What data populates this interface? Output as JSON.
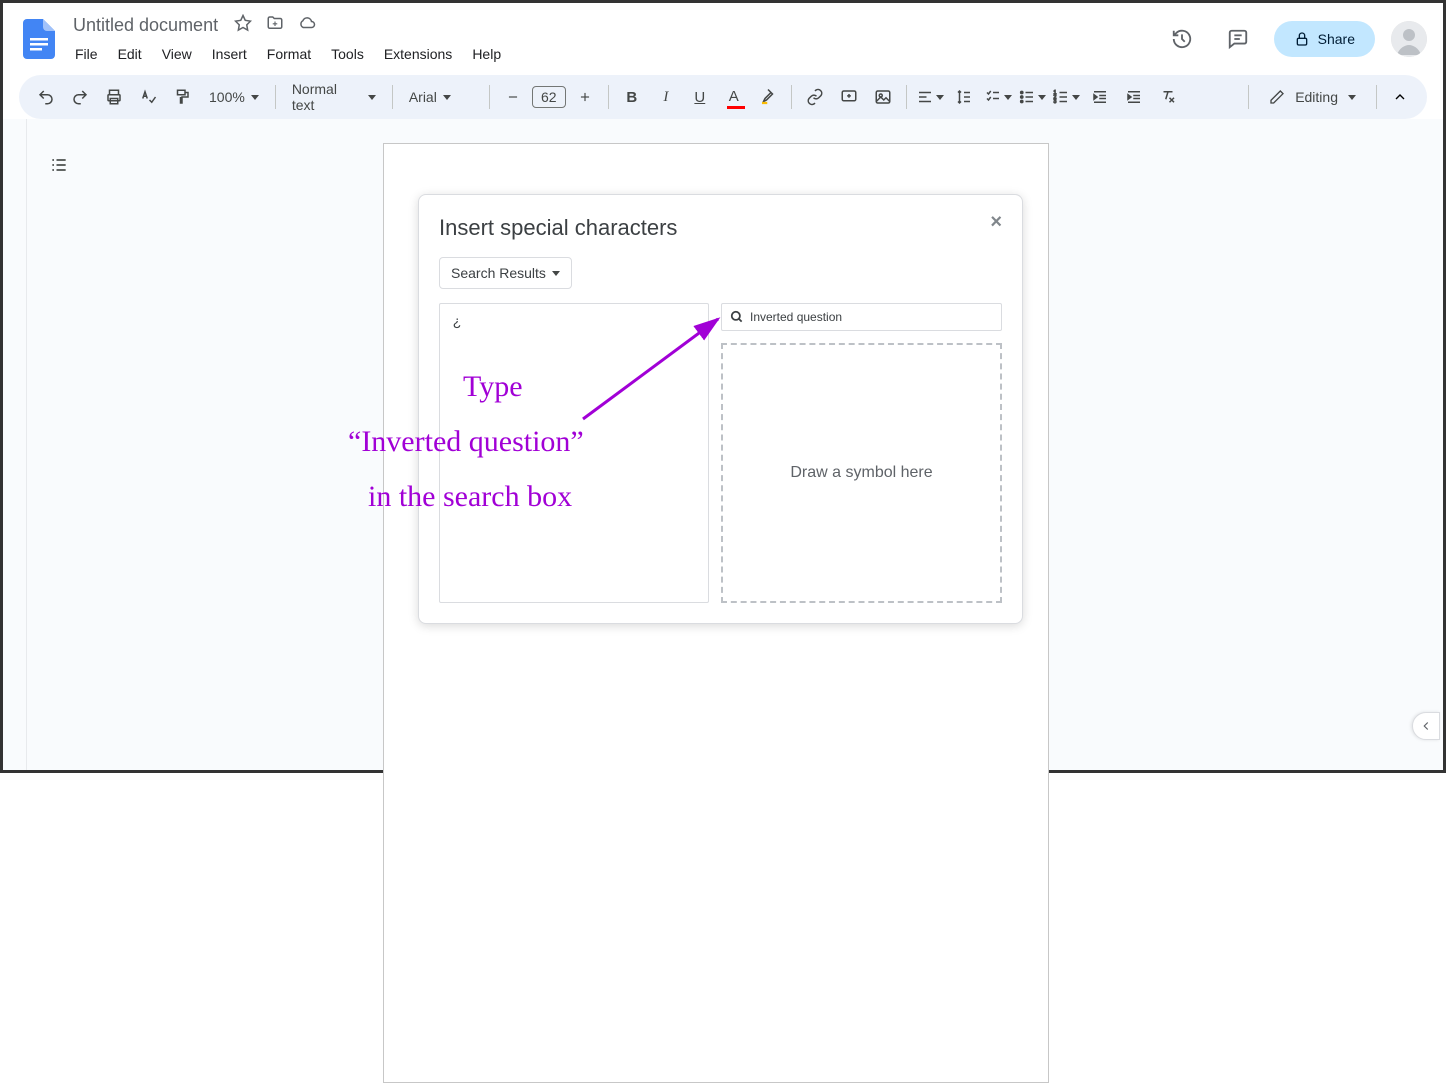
{
  "doc": {
    "title": "Untitled document"
  },
  "menus": [
    "File",
    "Edit",
    "View",
    "Insert",
    "Format",
    "Tools",
    "Extensions",
    "Help"
  ],
  "toolbar": {
    "zoom": "100%",
    "style": "Normal text",
    "font": "Arial",
    "fontsize": "62",
    "editing_label": "Editing"
  },
  "share": {
    "label": "Share"
  },
  "dialog": {
    "title": "Insert special characters",
    "filter_label": "Search Results",
    "search_value": "Inverted question",
    "result_char": "¿",
    "draw_hint": "Draw a symbol here"
  },
  "annotation": {
    "line1": "Type",
    "line2": "“Inverted question”",
    "line3": "in the search box"
  }
}
